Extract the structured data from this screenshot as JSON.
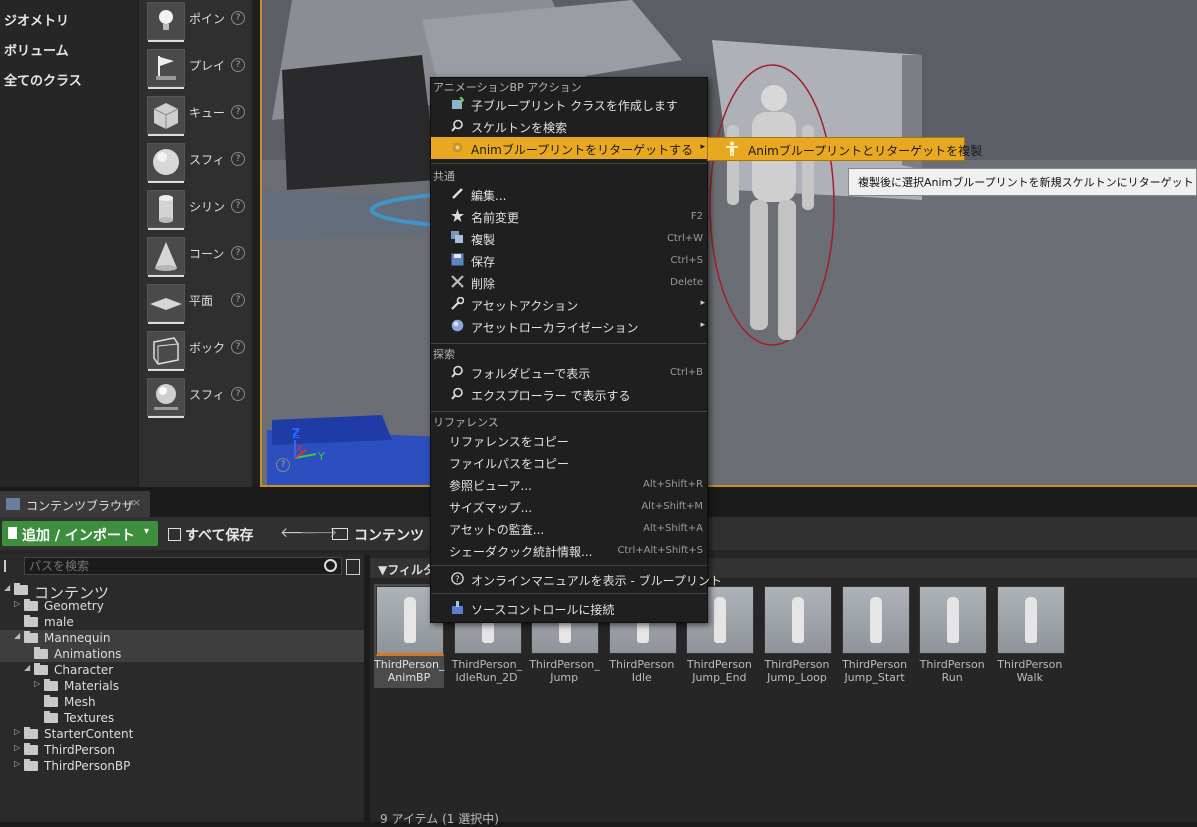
{
  "place_panel": {
    "categories": [
      "ジオメトリ",
      "ボリューム",
      "全てのクラス"
    ],
    "items": [
      {
        "label": "ポイン",
        "icon": "point-light-icon"
      },
      {
        "label": "プレイ",
        "icon": "player-start-icon"
      },
      {
        "label": "キュー",
        "icon": "cube-icon"
      },
      {
        "label": "スフィ",
        "icon": "sphere-icon"
      },
      {
        "label": "シリン",
        "icon": "cylinder-icon"
      },
      {
        "label": "コーン",
        "icon": "cone-icon"
      },
      {
        "label": "平面",
        "icon": "plane-icon"
      },
      {
        "label": "ボック",
        "icon": "box-icon"
      },
      {
        "label": "スフィ",
        "icon": "sphere-reflection-icon"
      }
    ],
    "help_glyph": "?"
  },
  "viewport": {
    "axis_z": "Z",
    "axis_x": "X",
    "axis_y": "Y",
    "help_glyph": "?"
  },
  "content_browser": {
    "tab_label": "コンテンツブラウザ",
    "tab_close": "×",
    "add_import_label": "追加 / インポート",
    "dropdown_glyph": "▾",
    "save_all_label": "すべて保存",
    "back_glyph": "🡐",
    "forward_glyph": "🡒",
    "path_label": "コンテンツ",
    "search_placeholder": "パスを検索",
    "filter_label": "▼フィルタ",
    "status": "9 アイテム (1 選択中)",
    "tree": [
      {
        "label": "コンテンツ",
        "depth": 0,
        "arrow": "◢",
        "root": true
      },
      {
        "label": "Geometry",
        "depth": 1,
        "arrow": "▷"
      },
      {
        "label": "male",
        "depth": 1,
        "arrow": ""
      },
      {
        "label": "Mannequin",
        "depth": 1,
        "arrow": "◢",
        "selected": true
      },
      {
        "label": "Animations",
        "depth": 2,
        "arrow": "",
        "selected": true
      },
      {
        "label": "Character",
        "depth": 2,
        "arrow": "◢"
      },
      {
        "label": "Materials",
        "depth": 3,
        "arrow": "▷"
      },
      {
        "label": "Mesh",
        "depth": 3,
        "arrow": ""
      },
      {
        "label": "Textures",
        "depth": 3,
        "arrow": ""
      },
      {
        "label": "StarterContent",
        "depth": 1,
        "arrow": "▷"
      },
      {
        "label": "ThirdPerson",
        "depth": 1,
        "arrow": "▷"
      },
      {
        "label": "ThirdPersonBP",
        "depth": 1,
        "arrow": "▷"
      }
    ],
    "assets": [
      {
        "line1": "ThirdPerson_",
        "line2": "AnimBP",
        "selected": true
      },
      {
        "line1": "ThirdPerson_",
        "line2": "IdleRun_2D"
      },
      {
        "line1": "ThirdPerson_",
        "line2": "Jump"
      },
      {
        "line1": "ThirdPerson",
        "line2": "Idle"
      },
      {
        "line1": "ThirdPerson",
        "line2": "Jump_End"
      },
      {
        "line1": "ThirdPerson",
        "line2": "Jump_Loop"
      },
      {
        "line1": "ThirdPerson",
        "line2": "Jump_Start"
      },
      {
        "line1": "ThirdPerson",
        "line2": "Run"
      },
      {
        "line1": "ThirdPerson",
        "line2": "Walk"
      }
    ]
  },
  "context_menu": {
    "sections": {
      "anim_bp": "アニメーションBP アクション",
      "common": "共通",
      "explore": "探索",
      "reference": "リファレンス"
    },
    "items": {
      "create_child": {
        "label": "子ブループリント クラスを作成します",
        "icon": "create-child-icon"
      },
      "find_skeleton": {
        "label": "スケルトンを検索",
        "icon": "search-icon"
      },
      "retarget": {
        "label": "Animブループリントをリターゲットする",
        "icon": "retarget-icon",
        "submenu": "▸"
      },
      "edit": {
        "label": "編集...",
        "icon": "edit-icon"
      },
      "rename": {
        "label": "名前変更",
        "shortcut": "F2",
        "icon": "rename-icon"
      },
      "duplicate": {
        "label": "複製",
        "shortcut": "Ctrl+W",
        "icon": "duplicate-icon"
      },
      "save": {
        "label": "保存",
        "shortcut": "Ctrl+S",
        "icon": "save-icon"
      },
      "delete": {
        "label": "削除",
        "shortcut": "Delete",
        "icon": "delete-icon"
      },
      "asset_actions": {
        "label": "アセットアクション",
        "icon": "wrench-icon",
        "submenu": "▸"
      },
      "localization": {
        "label": "アセットローカライゼーション",
        "icon": "globe-icon",
        "submenu": "▸"
      },
      "show_in_folder": {
        "label": "フォルダビューで表示",
        "shortcut": "Ctrl+B",
        "icon": "search-icon"
      },
      "show_in_explorer": {
        "label": "エクスプローラー で表示する",
        "icon": "search-icon"
      },
      "copy_reference": {
        "label": "リファレンスをコピー"
      },
      "copy_file_path": {
        "label": "ファイルパスをコピー"
      },
      "reference_viewer": {
        "label": "参照ビューア...",
        "shortcut": "Alt+Shift+R"
      },
      "size_map": {
        "label": "サイズマップ...",
        "shortcut": "Alt+Shift+M"
      },
      "audit": {
        "label": "アセットの監査...",
        "shortcut": "Alt+Shift+A"
      },
      "shader_stats": {
        "label": "シェーダクック統計情報...",
        "shortcut": "Ctrl+Alt+Shift+S"
      },
      "online_manual": {
        "label": "オンラインマニュアルを表示 - ブループリント",
        "icon": "help-icon"
      },
      "source_control": {
        "label": "ソースコントロールに接続",
        "icon": "source-control-icon"
      }
    },
    "submenu_item": "Animブループリントとリターゲットを複製",
    "tooltip": "複製後に選択Animブループリントを新規スケルトンにリターゲットします。"
  },
  "colors": {
    "highlight": "#e8a921",
    "add_button": "#3d8f3d",
    "viewport_border": "#c8911f",
    "selection_bar": "#d4762a"
  }
}
